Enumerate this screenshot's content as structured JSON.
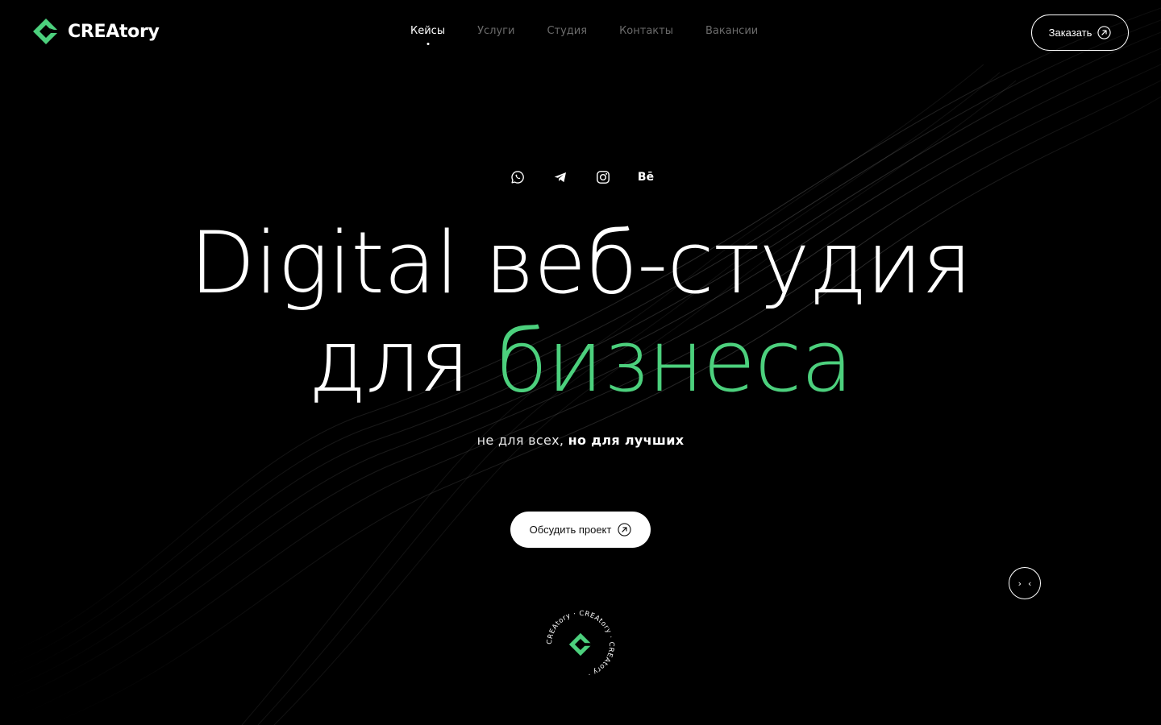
{
  "brand": {
    "name": "CREAtory",
    "accent_color": "#4cd07d"
  },
  "nav": {
    "items": [
      {
        "label": "Кейсы",
        "active": true
      },
      {
        "label": "Услуги",
        "active": false
      },
      {
        "label": "Студия",
        "active": false
      },
      {
        "label": "Контакты",
        "active": false
      },
      {
        "label": "Вакансии",
        "active": false
      }
    ]
  },
  "header": {
    "order_label": "Заказать"
  },
  "socials": [
    {
      "icon": "whatsapp-icon"
    },
    {
      "icon": "telegram-icon"
    },
    {
      "icon": "instagram-icon"
    },
    {
      "icon": "behance-icon",
      "label": "Bē"
    }
  ],
  "hero": {
    "line1": "Digital веб-студия",
    "line2_prefix": "для ",
    "line2_accent": "бизнеса",
    "tagline_regular": "не для всех, ",
    "tagline_bold": "но для лучших",
    "cta_label": "Обсудить проект"
  },
  "slider": {
    "next_glyph": "›",
    "prev_glyph": "‹"
  },
  "badge": {
    "ring_text": "CREAtory · CREAtory · CREAtory ·"
  }
}
